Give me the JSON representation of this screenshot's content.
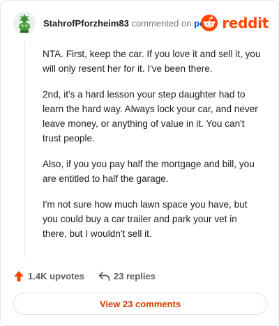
{
  "header": {
    "username": "StahrofPforzheim83",
    "action_text": "commented on",
    "post_link": "post",
    "logo_text": "reddit",
    "avatar_icon": "snoo-avatar-icon",
    "logo_icon": "reddit-snoo-icon"
  },
  "comment": {
    "paragraphs": [
      "NTA. First, keep the car. If you love it and sell it, you will only resent her for it. I've been there.",
      "2nd, it's a hard lesson your step daughter had to learn the hard way. Always lock your car, and never leave money, or anything of value in it. You can't trust people.",
      "Also, if you you pay half the mortgage and bill, you are entitled to half the garage.",
      "I'm not sure how much lawn space you have, but you could buy a car trailer and park your vet in there, but I wouldn't sell it."
    ]
  },
  "actions": {
    "upvotes": "1.4K upvotes",
    "replies": "23 replies",
    "upvote_icon": "upvote-arrow-icon",
    "reply_icon": "reply-arrow-icon"
  },
  "footer": {
    "view_comments": "View 23 comments"
  },
  "colors": {
    "brand": "#ff4500",
    "link": "#0a57c2",
    "button_text": "#d93a00"
  }
}
